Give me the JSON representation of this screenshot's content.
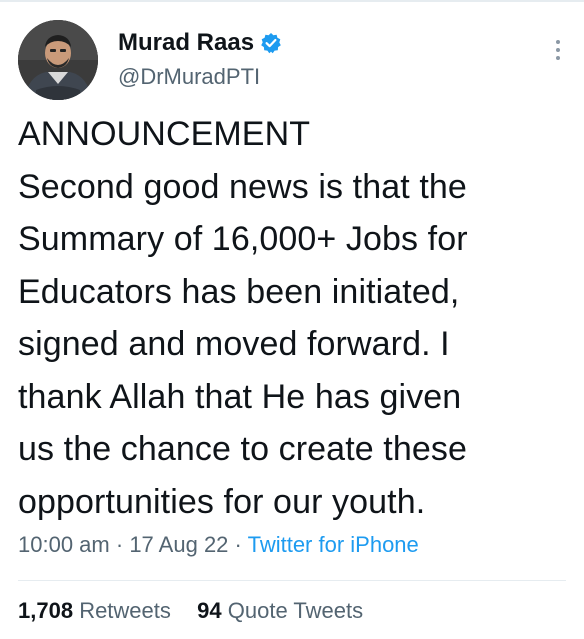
{
  "tweet": {
    "author": {
      "display_name": "Murad Raas",
      "handle": "@DrMuradPTI",
      "verified": true
    },
    "text_lines": [
      "ANNOUNCEMENT",
      "Second good news is that the",
      "Summary of 16,000+ Jobs for",
      "Educators has been initiated,",
      "signed and moved forward. I",
      "thank Allah that He has given",
      "us the chance to create these",
      "opportunities for our youth."
    ],
    "time": "10:00 am",
    "date": "17 Aug 22",
    "source": "Twitter for iPhone",
    "separator": "·",
    "stats": {
      "retweets_count": "1,708",
      "retweets_label": "Retweets",
      "quotes_count": "94",
      "quotes_label": "Quote Tweets"
    }
  },
  "icons": {
    "verified": "verified-badge-icon",
    "more": "more-options-icon"
  },
  "colors": {
    "primary_text": "#0f1419",
    "secondary_text": "#536471",
    "accent": "#1d9bf0",
    "divider": "#e6ecf0"
  }
}
